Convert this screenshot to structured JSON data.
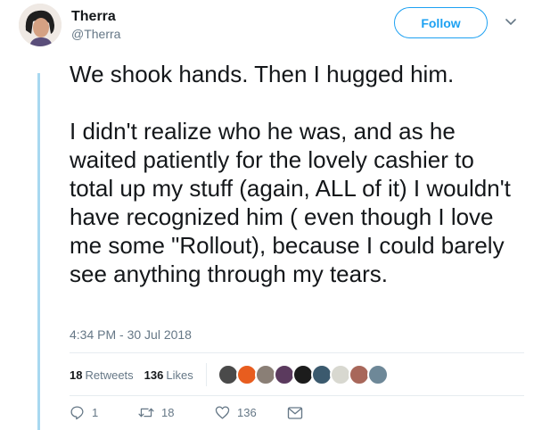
{
  "user": {
    "display_name": "Therra",
    "handle": "@Therra",
    "avatar_icon": "profile-photo"
  },
  "follow_button": {
    "label": "Follow"
  },
  "caret_icon": "chevron-down-icon",
  "tweet": {
    "paragraph_1": "We shook hands. Then I hugged him.",
    "paragraph_2": "I didn't realize who he was, and as he waited patiently for the lovely cashier to total up my stuff (again, ALL of it) I wouldn't have recognized him ( even though I love me some \"Rollout), because I could barely see anything through my tears.",
    "timestamp": "4:34 PM - 30 Jul 2018"
  },
  "stats": {
    "retweets_count": "18",
    "retweets_label": "Retweets",
    "likes_count": "136",
    "likes_label": "Likes"
  },
  "liker_avatars": [
    {
      "name": "liker-avatar-1",
      "color": "#4a4a4a"
    },
    {
      "name": "liker-avatar-2",
      "color": "#e85d1f"
    },
    {
      "name": "liker-avatar-3",
      "color": "#8a7f76"
    },
    {
      "name": "liker-avatar-4",
      "color": "#5b3a5e"
    },
    {
      "name": "liker-avatar-5",
      "color": "#1c1c1c"
    },
    {
      "name": "liker-avatar-6",
      "color": "#3b5a6e"
    },
    {
      "name": "liker-avatar-7",
      "color": "#d8d8d0"
    },
    {
      "name": "liker-avatar-8",
      "color": "#a8675a"
    },
    {
      "name": "liker-avatar-9",
      "color": "#6e8898"
    }
  ],
  "actions": {
    "reply_count": "1",
    "retweet_count": "18",
    "like_count": "136"
  },
  "colors": {
    "accent": "#1da1f2",
    "secondary_text": "#657786",
    "thread_line": "#a8d8f0"
  }
}
